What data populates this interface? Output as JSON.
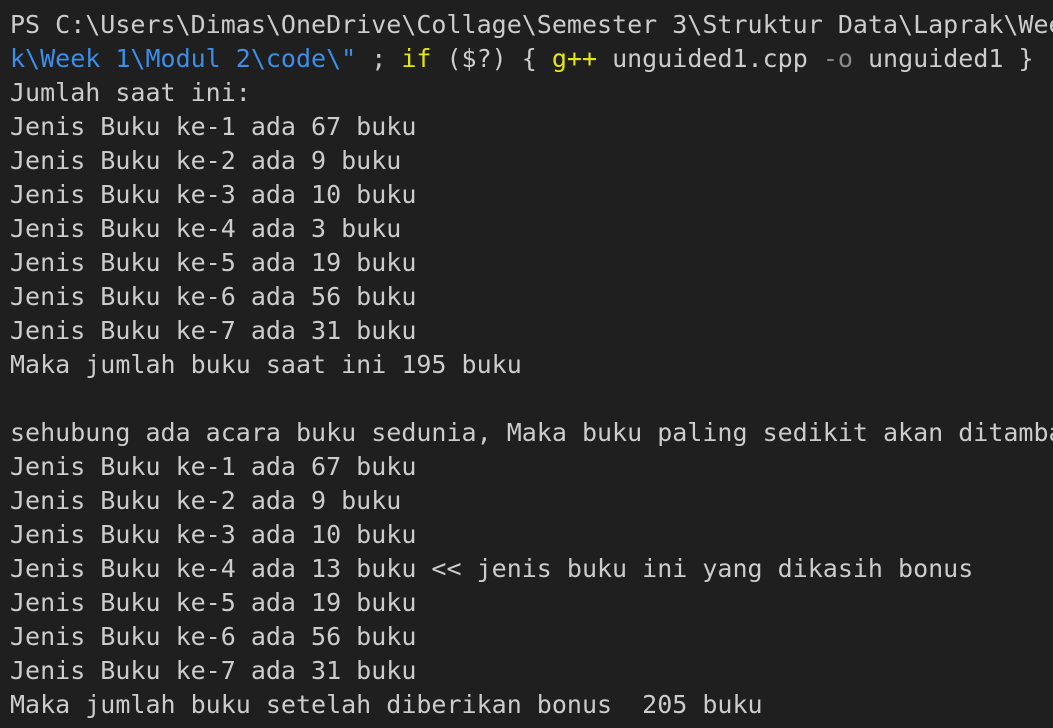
{
  "terminal": {
    "prompt_line_1": "PS C:\\Users\\Dimas\\OneDrive\\Collage\\Semester 3\\Struktur Data\\Laprak\\Wee",
    "prompt_line_2": {
      "path": "k\\Week 1\\Modul 2\\code\\\"",
      "sep1": " ; ",
      "if_kw": "if",
      "cond": " ($?) { ",
      "compiler": "g++",
      "file": " unguided1.cpp ",
      "flag": "-o",
      "out": " unguided1 } ;"
    },
    "output": [
      "Jumlah saat ini:",
      "Jenis Buku ke-1 ada 67 buku",
      "Jenis Buku ke-2 ada 9 buku",
      "Jenis Buku ke-3 ada 10 buku",
      "Jenis Buku ke-4 ada 3 buku",
      "Jenis Buku ke-5 ada 19 buku",
      "Jenis Buku ke-6 ada 56 buku",
      "Jenis Buku ke-7 ada 31 buku",
      "Maka jumlah buku saat ini 195 buku",
      "",
      "sehubung ada acara buku sedunia, Maka buku paling sedikit akan ditamba",
      "Jenis Buku ke-1 ada 67 buku",
      "Jenis Buku ke-2 ada 9 buku",
      "Jenis Buku ke-3 ada 10 buku",
      "Jenis Buku ke-4 ada 13 buku << jenis buku ini yang dikasih bonus",
      "Jenis Buku ke-5 ada 19 buku",
      "Jenis Buku ke-6 ada 56 buku",
      "Jenis Buku ke-7 ada 31 buku",
      "Maka jumlah buku setelah diberikan bonus  205 buku"
    ]
  }
}
